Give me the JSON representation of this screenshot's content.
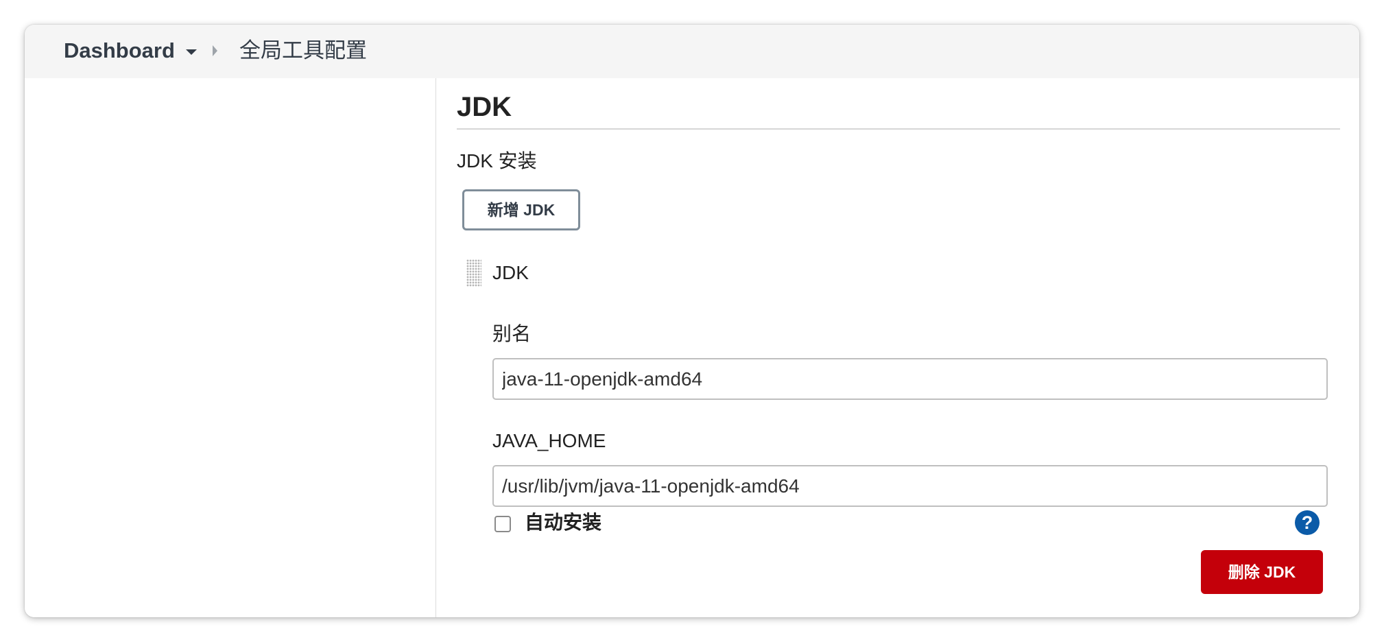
{
  "breadcrumb": {
    "root": "Dashboard",
    "current": "全局工具配置"
  },
  "section": {
    "title": "JDK",
    "install_label": "JDK 安装",
    "add_button": "新增 JDK"
  },
  "jdk_entry": {
    "title": "JDK",
    "alias_label": "别名",
    "alias_value": "java-11-openjdk-amd64",
    "java_home_label": "JAVA_HOME",
    "java_home_value": "/usr/lib/jvm/java-11-openjdk-amd64",
    "auto_install_label": "自动安装",
    "auto_install_checked": false,
    "help_glyph": "?",
    "delete_button": "删除 JDK"
  },
  "icons": {
    "dropdown": "chevron-down-icon",
    "separator": "chevron-right-icon",
    "drag": "drag-handle-icon",
    "help": "help-icon"
  },
  "colors": {
    "breadcrumb_bg": "#f5f5f5",
    "delete_button_bg": "#c4000a",
    "help_icon_bg": "#0b5ba8",
    "add_button_border": "#7f8d99"
  }
}
